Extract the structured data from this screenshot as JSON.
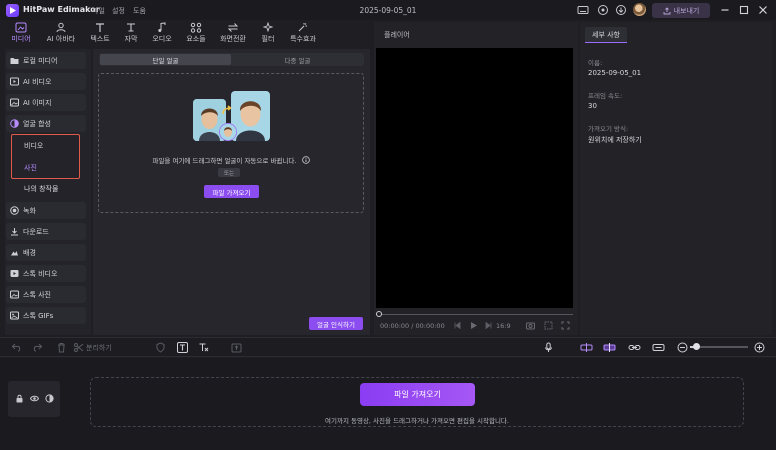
{
  "titlebar": {
    "app_name": "HitPaw Edimakor",
    "menu": [
      "파일",
      "설정",
      "도움"
    ],
    "document_title": "2025-09-05_01",
    "export_label": "내보내기"
  },
  "tabs": [
    {
      "label": "미디어",
      "icon": "media-icon",
      "active": true
    },
    {
      "label": "AI 아바타",
      "icon": "avatar-icon",
      "active": false
    },
    {
      "label": "텍스트",
      "icon": "text-icon",
      "active": false
    },
    {
      "label": "자막",
      "icon": "subtitle-icon",
      "active": false
    },
    {
      "label": "오디오",
      "icon": "audio-icon",
      "active": false
    },
    {
      "label": "요소들",
      "icon": "elements-icon",
      "active": false
    },
    {
      "label": "화면전환",
      "icon": "transition-icon",
      "active": false
    },
    {
      "label": "필터",
      "icon": "filter-icon",
      "active": false
    },
    {
      "label": "특수효과",
      "icon": "effects-icon",
      "active": false
    }
  ],
  "sidebar": {
    "items": [
      {
        "label": "로컬 미디어",
        "icon": "folder-icon"
      },
      {
        "label": "AI 비디오",
        "icon": "ai-video-icon"
      },
      {
        "label": "AI 이미지",
        "icon": "ai-image-icon"
      },
      {
        "label": "얼굴 합성",
        "icon": "face-swap-icon"
      },
      {
        "label": "녹화",
        "icon": "record-icon"
      },
      {
        "label": "다운로드",
        "icon": "download-icon"
      },
      {
        "label": "배경",
        "icon": "background-icon"
      },
      {
        "label": "스톡 비디오",
        "icon": "stock-video-icon"
      },
      {
        "label": "스톡 사진",
        "icon": "stock-photo-icon"
      },
      {
        "label": "스톡 GIFs",
        "icon": "gif-icon"
      }
    ],
    "face_swap_sub": [
      "비디오",
      "사진"
    ],
    "my_creations": "나의 창작물"
  },
  "faceswap": {
    "segments": [
      "단일 얼굴",
      "다중 얼굴"
    ],
    "drop_message": "파일을 여기에 드래그하면 얼굴이 자동으로 바뀝니다.",
    "or_label": "또는",
    "import_label": "파일 가져오기",
    "recognize_label": "얼굴 인식하기"
  },
  "player": {
    "label": "플레이어",
    "timecode": "00:00:00 / 00:00:00",
    "ratio": "16:9"
  },
  "properties": {
    "tab_label": "세부 사항",
    "fields": [
      {
        "label": "이름:",
        "value": "2025-09-05_01"
      },
      {
        "label": "프레임 속도:",
        "value": "30"
      },
      {
        "label": "가져오기 방식:",
        "value": "원위치에 저장하기"
      }
    ]
  },
  "timeline": {
    "split_label": "분리하기",
    "import_label": "파일 가져오기",
    "hint": "여기까지 동영상, 사진을 드래그하거나 가져오면 편집을 시작합니다."
  },
  "colors": {
    "accent": "#8b4cf0",
    "active_text": "#b68cff",
    "highlight_box": "#e05a4a"
  }
}
